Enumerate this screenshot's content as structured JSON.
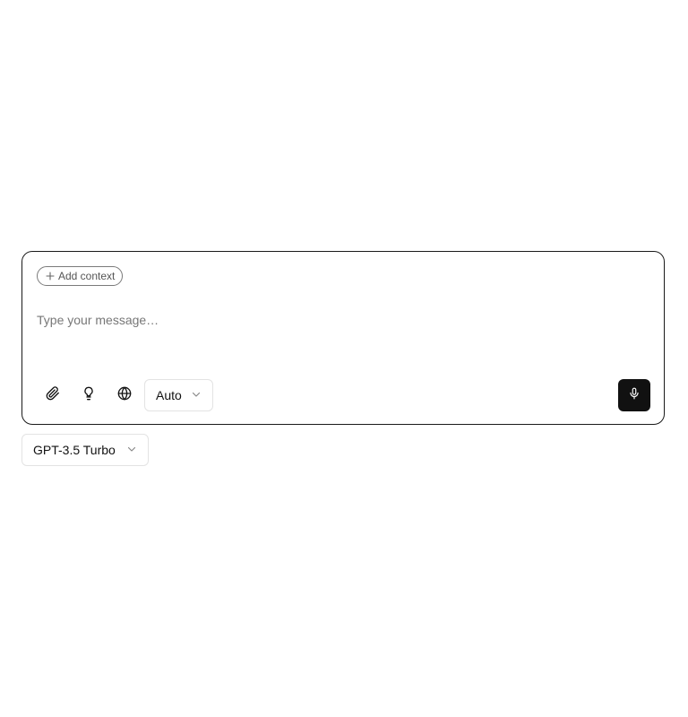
{
  "composer": {
    "add_context_label": "Add context",
    "message_placeholder": "Type your message…",
    "message_value": "",
    "tools": {
      "attach_icon": "paperclip-icon",
      "idea_icon": "lightbulb-icon",
      "web_icon": "globe-icon"
    },
    "mode_select": {
      "selected": "Auto"
    },
    "mic_icon": "microphone-icon"
  },
  "model_select": {
    "selected": "GPT-3.5 Turbo"
  },
  "colors": {
    "border": "#1a1a1a",
    "muted_border": "#e3e3e3",
    "primary_button": "#111111",
    "placeholder": "#777777"
  }
}
